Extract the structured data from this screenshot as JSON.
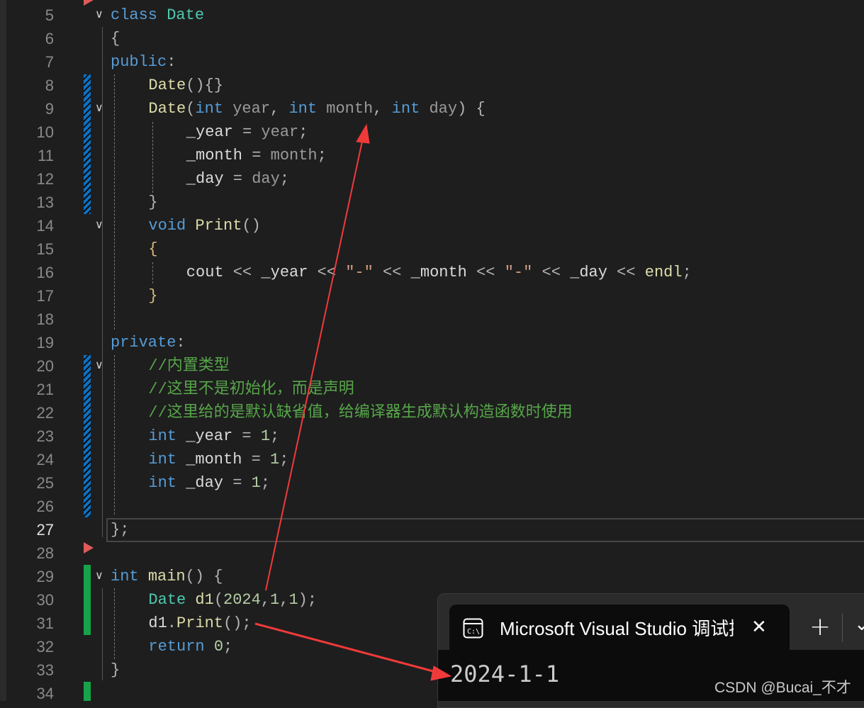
{
  "editor": {
    "current_line": 27,
    "lines": [
      {
        "n": 5,
        "indent": 0,
        "t": [
          [
            "class ",
            "kw"
          ],
          [
            "Date",
            "ty"
          ]
        ]
      },
      {
        "n": 6,
        "indent": 0,
        "t": [
          [
            "{",
            "pu"
          ]
        ]
      },
      {
        "n": 7,
        "indent": 0,
        "t": [
          [
            "public",
            "kw"
          ],
          [
            ":",
            "pu"
          ]
        ]
      },
      {
        "n": 8,
        "indent": 4,
        "t": [
          [
            "Date",
            "fn"
          ],
          [
            "(){}",
            "pu"
          ]
        ]
      },
      {
        "n": 9,
        "indent": 4,
        "t": [
          [
            "Date",
            "fn"
          ],
          [
            "(",
            "pu"
          ],
          [
            "int ",
            "kw"
          ],
          [
            "year",
            "pm"
          ],
          [
            ", ",
            "pu"
          ],
          [
            "int ",
            "kw"
          ],
          [
            "month",
            "pm"
          ],
          [
            ", ",
            "pu"
          ],
          [
            "int ",
            "kw"
          ],
          [
            "day",
            "pm"
          ],
          [
            ") {",
            "pu"
          ]
        ]
      },
      {
        "n": 10,
        "indent": 8,
        "t": [
          [
            "_year",
            ""
          ],
          [
            " = ",
            "pu"
          ],
          [
            "year",
            "pm"
          ],
          [
            ";",
            "pu"
          ]
        ]
      },
      {
        "n": 11,
        "indent": 8,
        "t": [
          [
            "_month",
            ""
          ],
          [
            " = ",
            "pu"
          ],
          [
            "month",
            "pm"
          ],
          [
            ";",
            "pu"
          ]
        ]
      },
      {
        "n": 12,
        "indent": 8,
        "t": [
          [
            "_day",
            ""
          ],
          [
            " = ",
            "pu"
          ],
          [
            "day",
            "pm"
          ],
          [
            ";",
            "pu"
          ]
        ]
      },
      {
        "n": 13,
        "indent": 4,
        "t": [
          [
            "}",
            "pu"
          ]
        ]
      },
      {
        "n": 14,
        "indent": 4,
        "t": [
          [
            "void ",
            "kw"
          ],
          [
            "Print",
            "fn"
          ],
          [
            "()",
            "pu"
          ]
        ]
      },
      {
        "n": 15,
        "indent": 4,
        "t": [
          [
            "{",
            "br"
          ]
        ]
      },
      {
        "n": 16,
        "indent": 8,
        "t": [
          [
            "cout",
            ""
          ],
          [
            " << ",
            "pu"
          ],
          [
            "_year",
            ""
          ],
          [
            " << ",
            "pu"
          ],
          [
            "\"-\"",
            "st"
          ],
          [
            " << ",
            "pu"
          ],
          [
            "_month",
            ""
          ],
          [
            " << ",
            "pu"
          ],
          [
            "\"-\"",
            "st"
          ],
          [
            " << ",
            "pu"
          ],
          [
            "_day",
            ""
          ],
          [
            " << ",
            "pu"
          ],
          [
            "endl",
            "fn"
          ],
          [
            ";",
            "pu"
          ]
        ]
      },
      {
        "n": 17,
        "indent": 4,
        "t": [
          [
            "}",
            "br"
          ]
        ]
      },
      {
        "n": 18,
        "indent": 0,
        "t": []
      },
      {
        "n": 19,
        "indent": 0,
        "t": [
          [
            "private",
            "kw"
          ],
          [
            ":",
            "pu"
          ]
        ]
      },
      {
        "n": 20,
        "indent": 4,
        "t": [
          [
            "//内置类型",
            "cm"
          ]
        ]
      },
      {
        "n": 21,
        "indent": 4,
        "t": [
          [
            "//这里不是初始化，而是声明",
            "cm"
          ]
        ]
      },
      {
        "n": 22,
        "indent": 4,
        "t": [
          [
            "//这里给的是默认缺省值，给编译器生成默认构造函数时使用",
            "cm"
          ]
        ]
      },
      {
        "n": 23,
        "indent": 4,
        "t": [
          [
            "int ",
            "kw"
          ],
          [
            "_year",
            ""
          ],
          [
            " = ",
            "pu"
          ],
          [
            "1",
            "nu"
          ],
          [
            ";",
            "pu"
          ]
        ]
      },
      {
        "n": 24,
        "indent": 4,
        "t": [
          [
            "int ",
            "kw"
          ],
          [
            "_month",
            ""
          ],
          [
            " = ",
            "pu"
          ],
          [
            "1",
            "nu"
          ],
          [
            ";",
            "pu"
          ]
        ]
      },
      {
        "n": 25,
        "indent": 4,
        "t": [
          [
            "int ",
            "kw"
          ],
          [
            "_day",
            ""
          ],
          [
            " = ",
            "pu"
          ],
          [
            "1",
            "nu"
          ],
          [
            ";",
            "pu"
          ]
        ]
      },
      {
        "n": 26,
        "indent": 0,
        "t": []
      },
      {
        "n": 27,
        "indent": 0,
        "t": [
          [
            "};",
            "pu"
          ]
        ]
      },
      {
        "n": 28,
        "indent": 0,
        "t": []
      },
      {
        "n": 29,
        "indent": 0,
        "t": [
          [
            "int ",
            "kw"
          ],
          [
            "main",
            "fn"
          ],
          [
            "() {",
            "pu"
          ]
        ]
      },
      {
        "n": 30,
        "indent": 4,
        "t": [
          [
            "Date ",
            "ty"
          ],
          [
            "d1",
            "fn"
          ],
          [
            "(",
            "pu"
          ],
          [
            "2024",
            "nu"
          ],
          [
            ",",
            "pu"
          ],
          [
            "1",
            "nu"
          ],
          [
            ",",
            "pu"
          ],
          [
            "1",
            "nu"
          ],
          [
            ");",
            "pu"
          ]
        ]
      },
      {
        "n": 31,
        "indent": 4,
        "t": [
          [
            "d1",
            ""
          ],
          [
            ".",
            "pu"
          ],
          [
            "Print",
            "fn"
          ],
          [
            "();",
            "pu"
          ]
        ]
      },
      {
        "n": 32,
        "indent": 4,
        "t": [
          [
            "return ",
            "kw"
          ],
          [
            "0",
            "nu"
          ],
          [
            ";",
            "pu"
          ]
        ]
      },
      {
        "n": 33,
        "indent": 0,
        "t": [
          [
            "}",
            "pu"
          ]
        ]
      },
      {
        "n": 34,
        "indent": 0,
        "t": []
      }
    ],
    "fold_lines": [
      5,
      9,
      14,
      20,
      29
    ],
    "breakpoint_lines": [
      5,
      28
    ]
  },
  "terminal": {
    "tab_title": "Microsoft Visual Studio 调试控制台",
    "tab_icon": "console-icon",
    "close_label": "✕",
    "new_tab_label": "+",
    "dropdown_label": "⌄",
    "output": "2024-1-1"
  },
  "watermark": "CSDN @Bucai_不才",
  "colors": {
    "annotation_arrow": "#f03a3a",
    "keyword": "#569cd6",
    "type": "#4ec9b0",
    "comment": "#57a64a"
  }
}
